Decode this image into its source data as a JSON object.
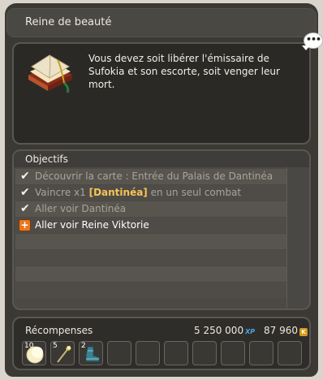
{
  "title": "Reine de beauté",
  "chat_bubble": "•••",
  "description": "Vous devez soit libérer l'émissaire de Sufokia et son escorte, soit venger leur mort.",
  "objectives": {
    "header": "Objectifs",
    "items": [
      {
        "status": "done",
        "text": "Découvrir la carte : Entrée du Palais de Dantinéa"
      },
      {
        "status": "done",
        "prefix": "Vaincre x1 ",
        "highlight": "[Dantinéa]",
        "suffix": " en un seul combat"
      },
      {
        "status": "done",
        "text": "Aller voir Dantinéa"
      },
      {
        "status": "active",
        "text": "Aller voir Reine Viktorie"
      }
    ]
  },
  "rewards": {
    "label": "Récompenses",
    "xp": "5 250 000",
    "xp_tag": "XP",
    "kamas": "87 960",
    "kamas_tag": "K",
    "items": [
      {
        "qty": "10",
        "icon": "moon-orb-icon"
      },
      {
        "qty": "5",
        "icon": "staff-icon"
      },
      {
        "qty": "2",
        "icon": "boot-icon"
      }
    ]
  },
  "colors": {
    "highlight": "#f7c357",
    "active_plus": "#e8761e",
    "xp": "#4aa3e6",
    "kamas": "#d99a1a"
  }
}
